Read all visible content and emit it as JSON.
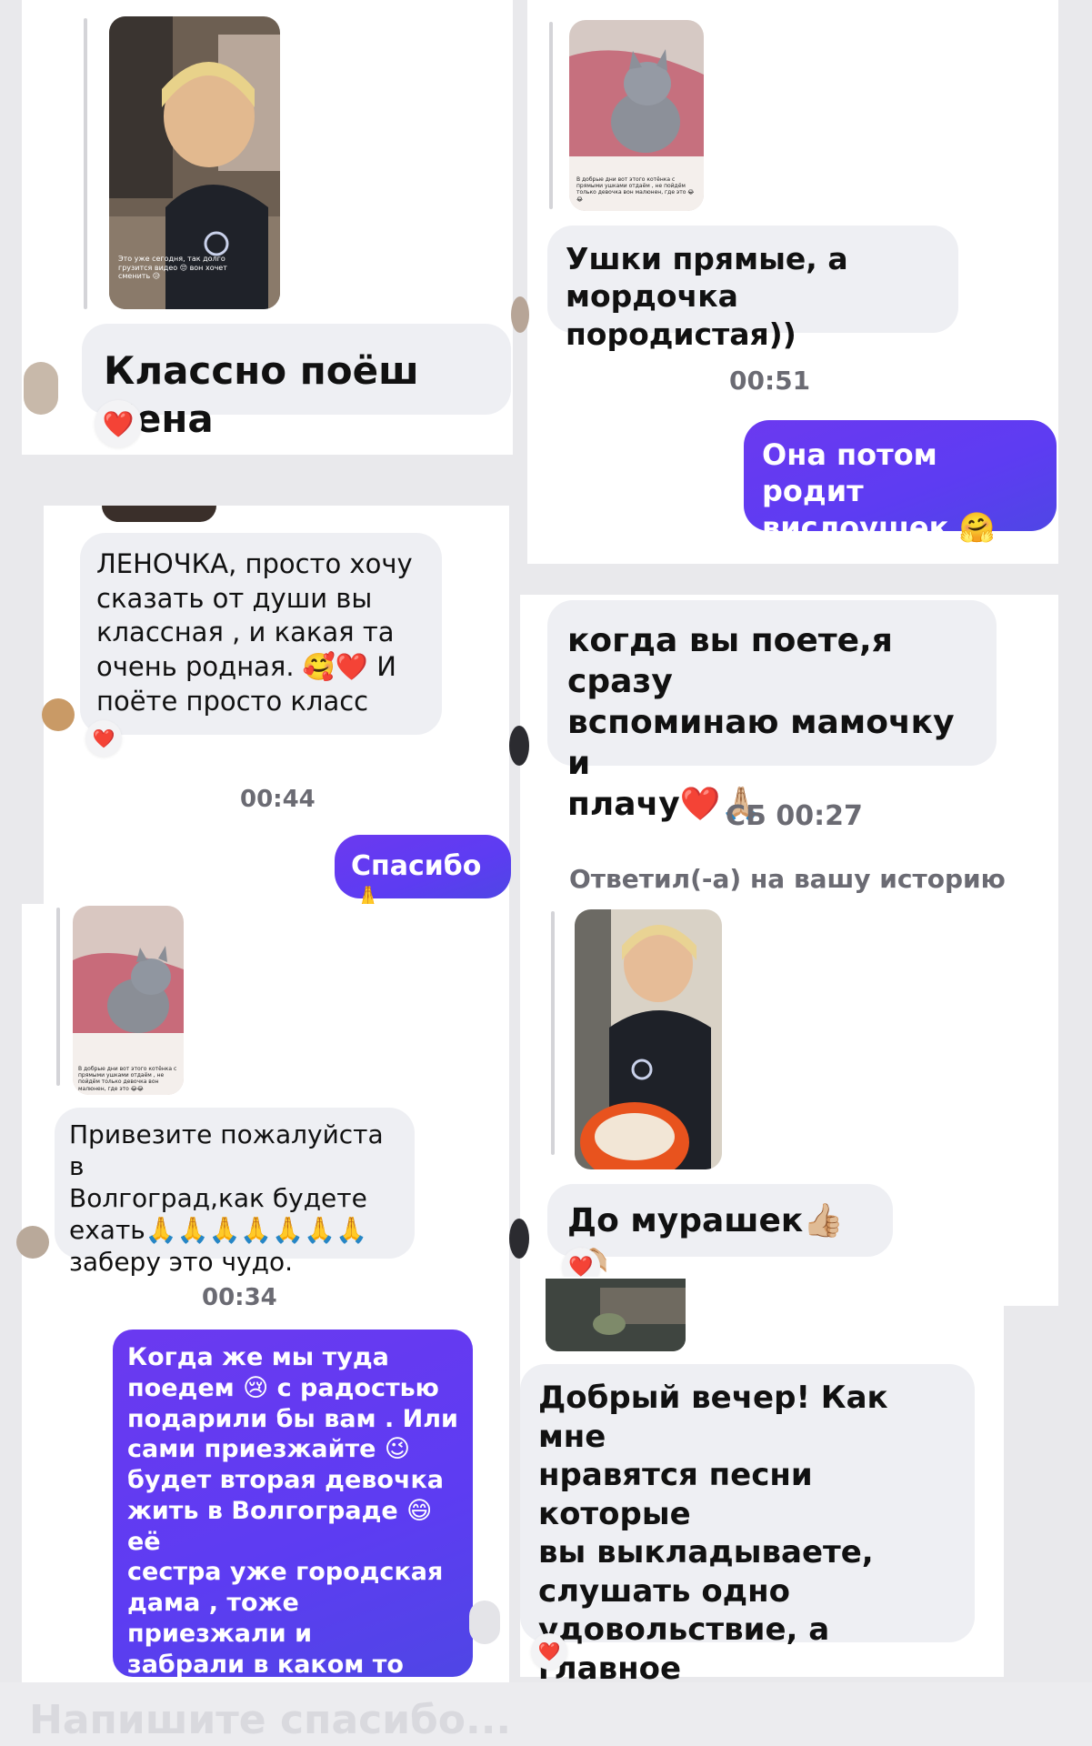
{
  "colors": {
    "outgoing": "#5d3cf2",
    "incoming": "#eeeff3",
    "heart": "#e01e37",
    "timestamp": "#6b6b73"
  },
  "left": {
    "story1_caption": "Это уже сегодня, так долго грузится видео 😔 вон хочет сменить 😥",
    "msg1": "Классно поёш Лена",
    "msg1_reaction": "❤️",
    "msg2": "ЛЕНОЧКА, просто хочу\nсказать от души  вы\nклассная , и какая  та\nочень родная. 🥰❤️ И\nпоёте  просто класс",
    "msg2_reaction": "❤️",
    "time1": "00:44",
    "out1": "Спасибо 🙏",
    "story2_caption": "В добрые дни вот этого котёнка с прямыми ушками отдаём , не пойдём только девочка вон малюнен, где это 😂😂",
    "msg3": "Привезите пожалуйста в\nВолгоград,как будете\nехать🙏🙏🙏🙏🙏🙏🙏\nзаберу это чудо.",
    "time2": "00:34",
    "out2": "Когда же мы туда\nпоедем 😢 с радостью\nподарили бы вам . Или\nсами приезжайте 😉\nбудет вторая девочка\nжить в Волгограде 😄 её\nсестра уже городская\nдама , тоже приезжали и\nзабрали в каком то году\n🤗"
  },
  "right": {
    "story1_caption": "В добрые дни вот этого котёнка с прямыми ушками отдаём , не пойдём только девочка вон малюнен, где это 😂😂",
    "msg1": "Ушки прямые, а\nмордочка породистая))",
    "time1": "00:51",
    "out1": "Она потом родит\nвислоушек 🤗",
    "msg2": "когда вы поете,я сразу\nвспоминаю мамочку и\nплачу❤️🙏🏼",
    "time2": "СБ 00:27",
    "reply_note": "Ответил(-а) на вашу историю",
    "msg3": "До мурашек👍🏼🫶🏼",
    "msg3_reaction": "❤️",
    "msg4": "Добрый вечер! Как мне\nнравятся песни которые\nвы выкладываете,\nслушать одно\nудовольствие, а главное\nсо смыслом. 👍",
    "msg4_reaction": "❤️"
  },
  "footer": {
    "faded_text": "Напишите спасибо..."
  }
}
